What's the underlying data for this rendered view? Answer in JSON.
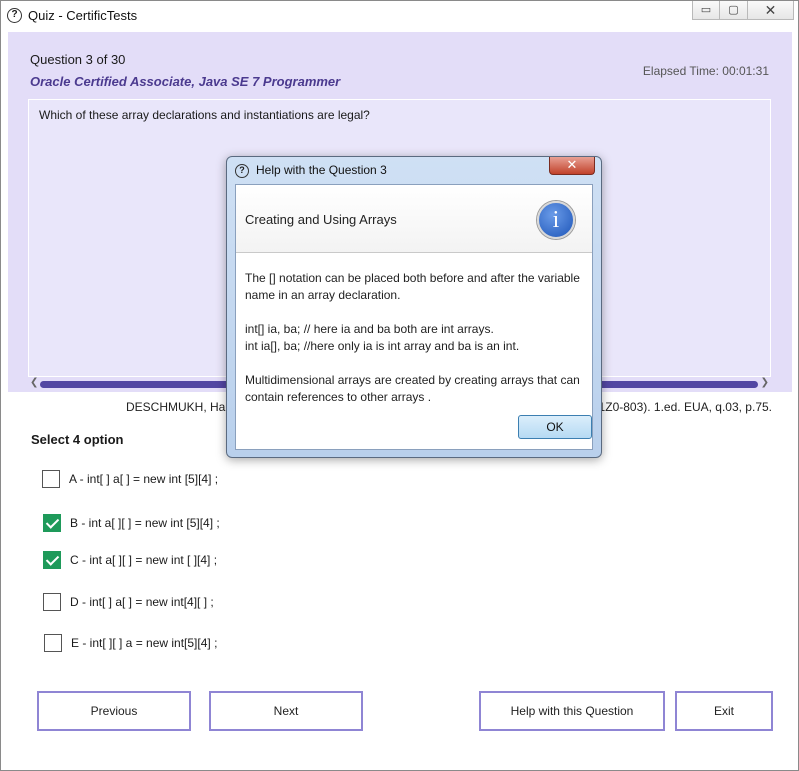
{
  "window": {
    "title": "Quiz - CertificTests",
    "controls": {
      "minimize": "▭",
      "maximize": "▢",
      "close": "✕"
    }
  },
  "header": {
    "question_number": "Question 3 of 30",
    "certification": "Oracle Certified Associate, Java SE 7 Programmer",
    "elapsed": "Elapsed Time: 00:01:31"
  },
  "question": {
    "text": "Which of these array declarations and instantiations are legal?"
  },
  "reference": {
    "left": "DESCHMUKH, Hand",
    "right": "(1Z0-803). 1.ed. EUA, q.03, p.75."
  },
  "select_label": "Select 4 option",
  "options": [
    {
      "label": "A - int[ ] a[ ] = new int [5][4] ;",
      "checked": false
    },
    {
      "label": "B - int a[ ][ ] = new int [5][4] ;",
      "checked": true
    },
    {
      "label": "C - int a[ ][ ] = new int [ ][4] ;",
      "checked": true
    },
    {
      "label": "D - int[ ] a[ ] = new int[4][ ] ;",
      "checked": false
    },
    {
      "label": "E - int[ ][ ] a = new int[5][4] ;",
      "checked": false
    }
  ],
  "buttons": {
    "previous": "Previous",
    "next": "Next",
    "help": "Help with this Question",
    "exit": "Exit"
  },
  "modal": {
    "title": "Help with the Question 3",
    "close": "✕",
    "heading": "Creating and Using Arrays",
    "info_icon": "i",
    "para1": "The [] notation can be placed both before and after the variable name in an array declaration.",
    "code1": "int[] ia, ba; // here ia and ba both are int arrays.",
    "code2": "int ia[], ba; //here only ia is int array and ba is an int.",
    "para2": "Multidimensional arrays are created by creating arrays that can contain references to other arrays .",
    "ok": "OK"
  },
  "colors": {
    "accent": "#8f85d4",
    "header_band": "#e3ddf8",
    "scroll_thumb": "#5347a3",
    "check": "#1e9a5a"
  }
}
